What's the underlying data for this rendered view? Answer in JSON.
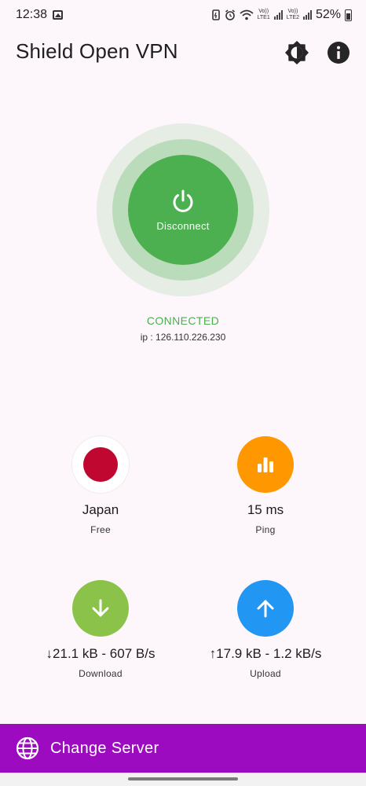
{
  "status_bar": {
    "time": "12:38",
    "battery": "52%",
    "net1": "Vo))\nLTE1",
    "net2": "Vo))\nLTE2"
  },
  "app": {
    "title": "Shield Open VPN",
    "theme_icon": "brightness-icon",
    "info_icon": "info-icon"
  },
  "connection": {
    "button_label": "Disconnect",
    "status": "CONNECTED",
    "ip": "ip : 126.110.226.230",
    "color": "#4caf50"
  },
  "tiles": {
    "country": {
      "value": "Japan",
      "label": "Free"
    },
    "ping": {
      "value": "15 ms",
      "label": "Ping",
      "color": "#ff9800"
    },
    "download": {
      "value": "↓21.1 kB - 607 B/s",
      "label": "Download",
      "color": "#8bc34a"
    },
    "upload": {
      "value": "↑17.9 kB - 1.2 kB/s",
      "label": "Upload",
      "color": "#2196f3"
    }
  },
  "bottom": {
    "label": "Change Server",
    "color": "#9c0bbf"
  }
}
